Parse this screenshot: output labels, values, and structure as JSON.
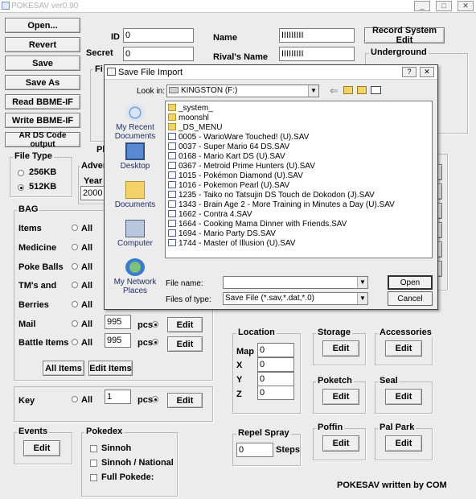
{
  "window": {
    "title": "POKESAV ver0.90",
    "min": "_",
    "max": "□",
    "close": "✕"
  },
  "left_buttons": [
    "Open...",
    "Revert",
    "Save",
    "Save As",
    "Read BBME-IF",
    "Write BBME-IF",
    "AR DS Code output"
  ],
  "header": {
    "id_label": "ID",
    "id_value": "0",
    "secret_label": "Secret",
    "secret_value": "0",
    "name_label": "Name",
    "name_value": "IIIIIIIII",
    "rival_label": "Rival's Name",
    "rival_value": "IIIIIIIII",
    "record_button": "Record System Edit",
    "underground": "Underground"
  },
  "filetype": {
    "title": "File Type",
    "opt1": "256KB",
    "opt2": "512KB"
  },
  "partial": {
    "fi": "Fi",
    "pl": "Pl",
    "adven": "Adven",
    "year": "Year",
    "year_value": "2000"
  },
  "bag": {
    "title": "BAG",
    "rows": [
      {
        "label": "Items",
        "all": "All"
      },
      {
        "label": "Medicine",
        "all": "All"
      },
      {
        "label": "Poke Balls",
        "all": "All"
      },
      {
        "label": "TM's and",
        "all": "All"
      },
      {
        "label": "Berries",
        "all": "All"
      },
      {
        "label": "Mail",
        "all": "All",
        "qty": "995",
        "pcs": "pcs",
        "edit": "Edit"
      },
      {
        "label": "Battle Items",
        "all": "All",
        "qty": "995",
        "pcs": "pcs",
        "edit": "Edit"
      }
    ],
    "all_items": "All Items",
    "edit_items": "Edit Items"
  },
  "key": {
    "label": "Key",
    "all": "All",
    "qty": "1",
    "pcs": "pcs",
    "edit": "Edit"
  },
  "events": {
    "title": "Events",
    "edit": "Edit"
  },
  "pokedex": {
    "title": "Pokedex",
    "opt1": "Sinnoh",
    "opt2": "Sinnoh / National",
    "opt3": "Full Pokede:"
  },
  "location": {
    "title": "Location",
    "map": "Map",
    "map_v": "0",
    "x": "X",
    "x_v": "0",
    "y": "Y",
    "y_v": "0",
    "z": "Z",
    "z_v": "0"
  },
  "repel": {
    "title": "Repel Spray",
    "value": "0",
    "steps": "Steps"
  },
  "storage": {
    "title": "Storage",
    "edit": "Edit"
  },
  "accessories": {
    "title": "Accessories",
    "edit": "Edit"
  },
  "poketch": {
    "title": "Poketch",
    "edit": "Edit"
  },
  "seal": {
    "title": "Seal",
    "edit": "Edit"
  },
  "poffin": {
    "title": "Poffin",
    "edit": "Edit"
  },
  "palpark": {
    "title": "Pal Park",
    "edit": "Edit"
  },
  "credit": "POKESAV written by COM",
  "right_edges": [
    "it",
    "it",
    "it",
    "it",
    "it",
    "it"
  ],
  "dialog": {
    "title": "Save File Import",
    "help": "?",
    "close": "✕",
    "lookin_label": "Look in:",
    "lookin_value": "KINGSTON (F:)",
    "places": [
      "My Recent Documents",
      "Desktop",
      "Documents",
      "Computer",
      "My Network Places"
    ],
    "files": [
      "_system_",
      "moonshl",
      "_DS_MENU",
      "0005 - WarioWare Touched! (U).SAV",
      "0037 - Super Mario 64 DS.SAV",
      "0168 - Mario Kart DS (U).SAV",
      "0367 - Metroid Prime Hunters (U).SAV",
      "1015 - Pokémon Diamond (U).SAV",
      "1016 - Pokemon Pearl (U).SAV",
      "1235 - Taiko no Tatsujin DS Touch de Dokodon (J).SAV",
      "1343 - Brain Age 2 - More Training in Minutes a Day (U).SAV",
      "1662 - Contra 4.SAV",
      "1664 - Cooking Mama Dinner with Friends.SAV",
      "1694 - Mario Party DS.SAV",
      "1744 - Master of Illusion (U).SAV"
    ],
    "filename_label": "File name:",
    "filename_value": "",
    "filetype_label": "Files of type:",
    "filetype_value": "Save File (*.sav,*.dat,*.0)",
    "open": "Open",
    "cancel": "Cancel"
  }
}
